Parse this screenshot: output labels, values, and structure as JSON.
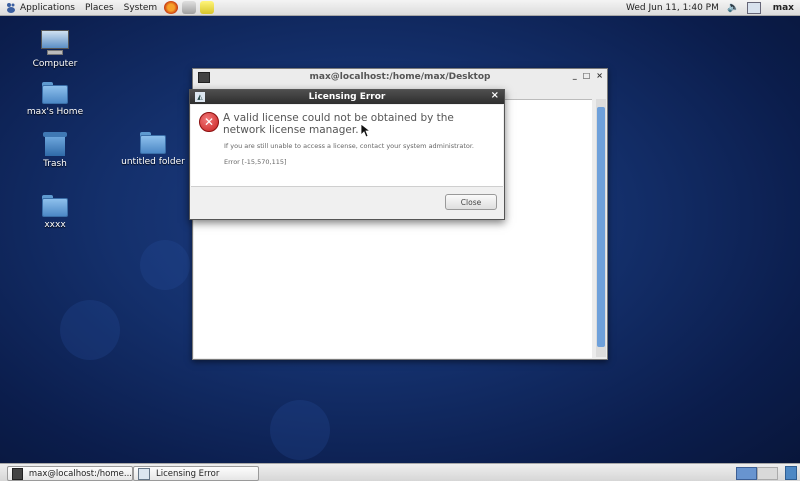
{
  "top_panel": {
    "menus": [
      "Applications",
      "Places",
      "System"
    ],
    "clock": "Wed Jun 11,  1:40 PM",
    "user": "max"
  },
  "desktop": {
    "icons": [
      {
        "label": "Computer"
      },
      {
        "label": "max's Home"
      },
      {
        "label": "Trash"
      },
      {
        "label": "untitled folder"
      },
      {
        "label": "xxxx"
      }
    ]
  },
  "terminal_window": {
    "title": "max@localhost:/home/max/Desktop",
    "controls": [
      "_",
      "□",
      "×"
    ]
  },
  "dialog": {
    "title": "Licensing Error",
    "close_glyph": "×",
    "message": "A valid license could not be obtained by the network license manager.",
    "sub_message": "If you are still unable to access a license, contact your system administrator.",
    "error_code": "Error [-15,570,115]",
    "close_button": "Close"
  },
  "taskbar": {
    "tasks": [
      {
        "label": "max@localhost:/home..."
      },
      {
        "label": "Licensing Error"
      }
    ]
  },
  "colors": {
    "desktop_bg": "#14306c",
    "error_red": "#c81e1e",
    "workspace_active": "#6894cf"
  }
}
